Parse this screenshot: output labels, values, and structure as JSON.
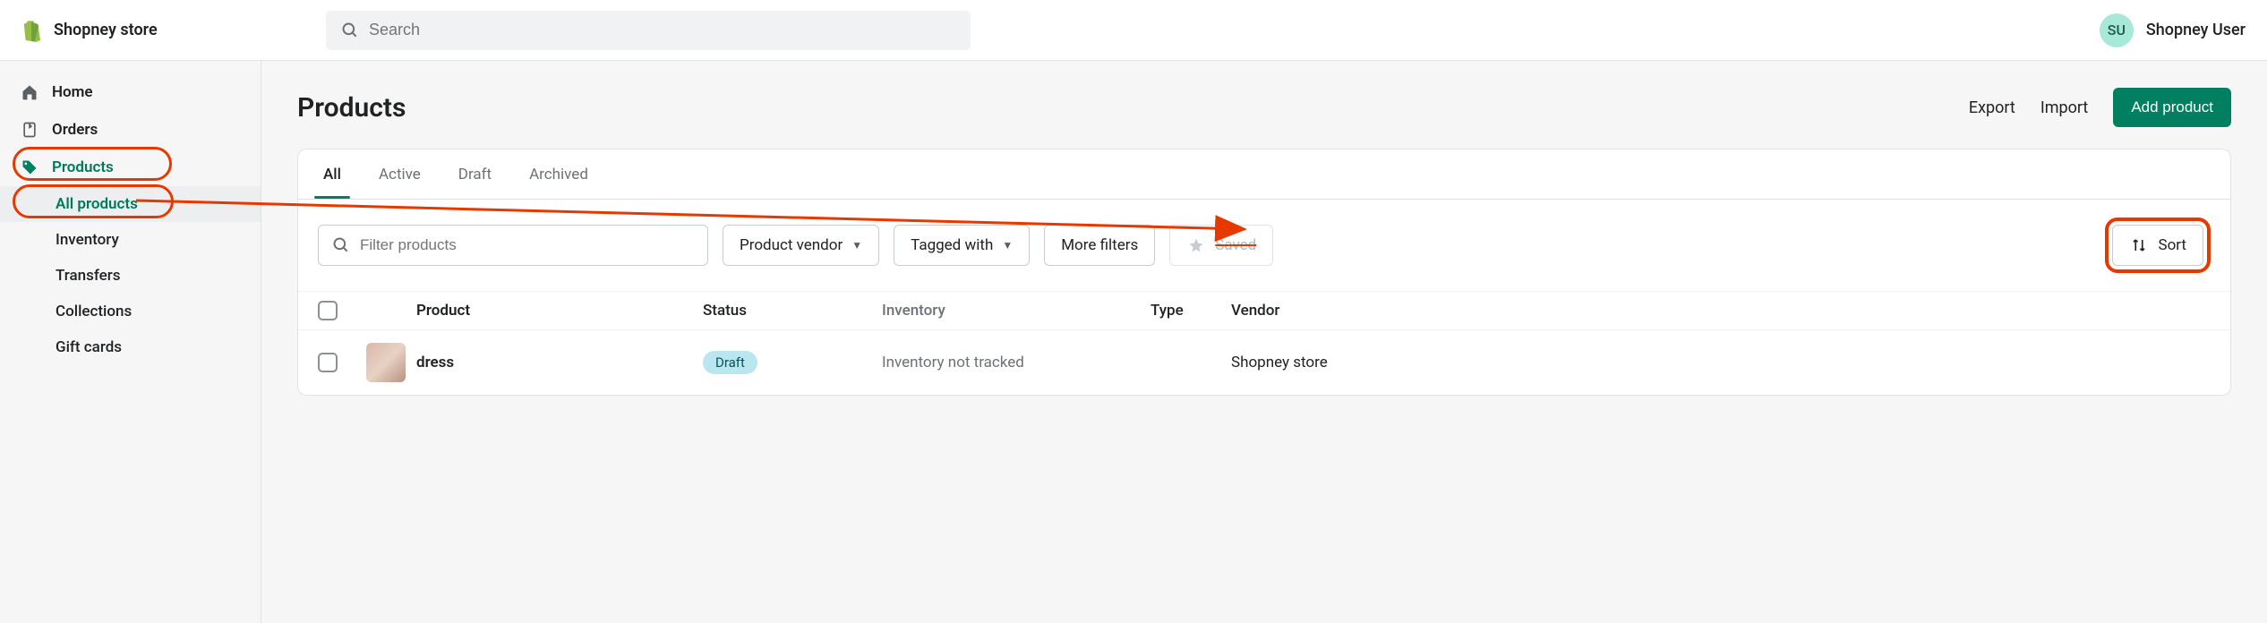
{
  "header": {
    "store_name": "Shopney store",
    "search_placeholder": "Search",
    "avatar_initials": "SU",
    "user_name": "Shopney User"
  },
  "sidebar": {
    "home": "Home",
    "orders": "Orders",
    "products": "Products",
    "sub": {
      "all_products": "All products",
      "inventory": "Inventory",
      "transfers": "Transfers",
      "collections": "Collections",
      "gift_cards": "Gift cards"
    }
  },
  "page": {
    "title": "Products",
    "export": "Export",
    "import": "Import",
    "add_product": "Add product"
  },
  "tabs": {
    "all": "All",
    "active": "Active",
    "draft": "Draft",
    "archived": "Archived"
  },
  "toolbar": {
    "filter_placeholder": "Filter products",
    "product_vendor": "Product vendor",
    "tagged_with": "Tagged with",
    "more_filters": "More filters",
    "saved": "Saved",
    "sort": "Sort"
  },
  "table": {
    "headers": {
      "product": "Product",
      "status": "Status",
      "inventory": "Inventory",
      "type": "Type",
      "vendor": "Vendor"
    },
    "rows": [
      {
        "name": "dress",
        "status": "Draft",
        "inventory": "Inventory not tracked",
        "type": "",
        "vendor": "Shopney store"
      }
    ]
  }
}
